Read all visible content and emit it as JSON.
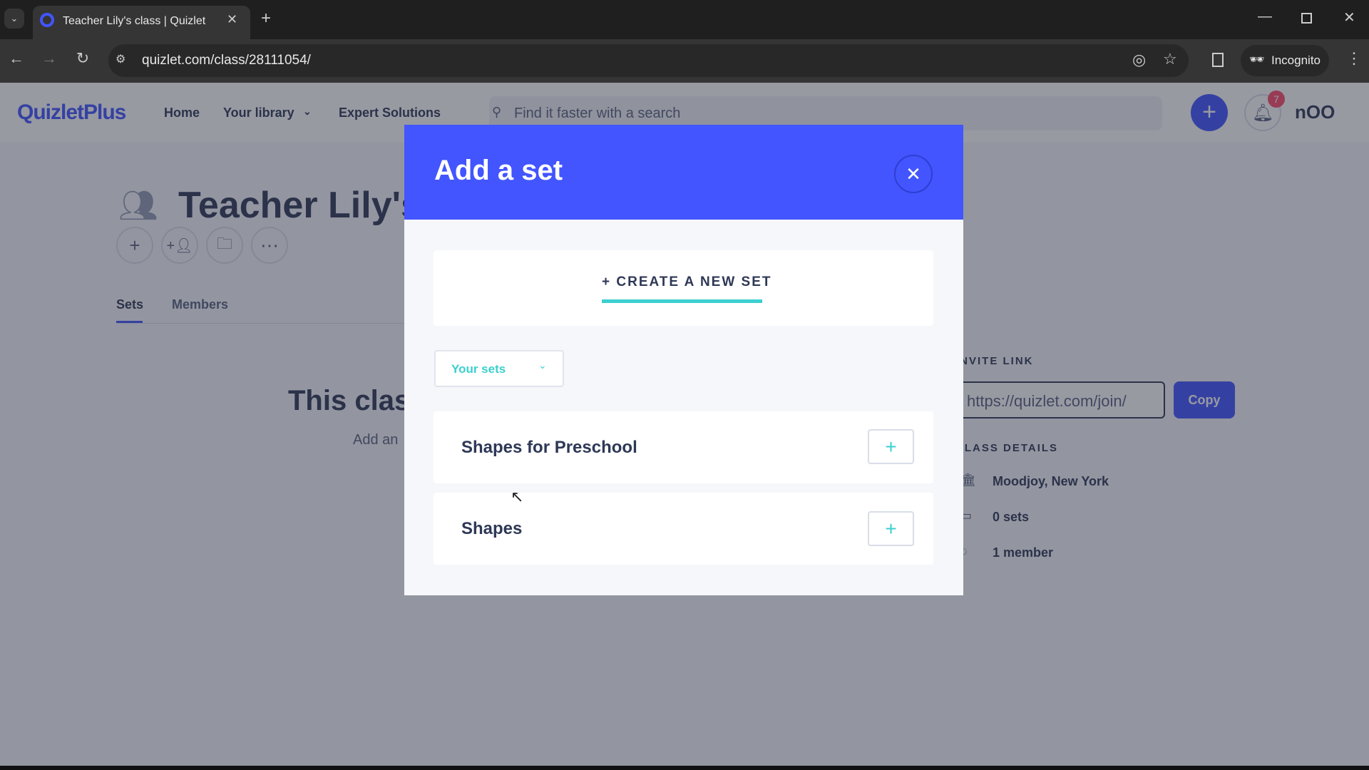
{
  "browser": {
    "tab_title": "Teacher Lily's class | Quizlet",
    "url": "quizlet.com/class/28111054/",
    "incognito_label": "Incognito",
    "new_tab": "+"
  },
  "nav": {
    "logo": "QuizletPlus",
    "links": [
      "Home",
      "Your library",
      "Expert Solutions"
    ],
    "search_placeholder": "Find it faster with a search",
    "notification_count": "7",
    "avatar_text": "nOO"
  },
  "class": {
    "title": "Teacher Lily's",
    "tabs": [
      "Sets",
      "Members"
    ],
    "empty_title": "This class",
    "empty_sub": "Add an",
    "invite_label": "INVITE LINK",
    "invite_url": "https://quizlet.com/join/",
    "copy_label": "Copy",
    "details_label": "CLASS DETAILS",
    "details": [
      "Moodjoy, New York",
      "0 sets",
      "1 member"
    ]
  },
  "modal": {
    "title": "Add a set",
    "create_label": "+ CREATE A NEW SET",
    "filter_selected": "Your sets",
    "sets": [
      "Shapes for Preschool",
      "Shapes"
    ]
  },
  "colors": {
    "brand": "#4255ff",
    "accent": "#3ccfcf",
    "text": "#2e3856"
  }
}
